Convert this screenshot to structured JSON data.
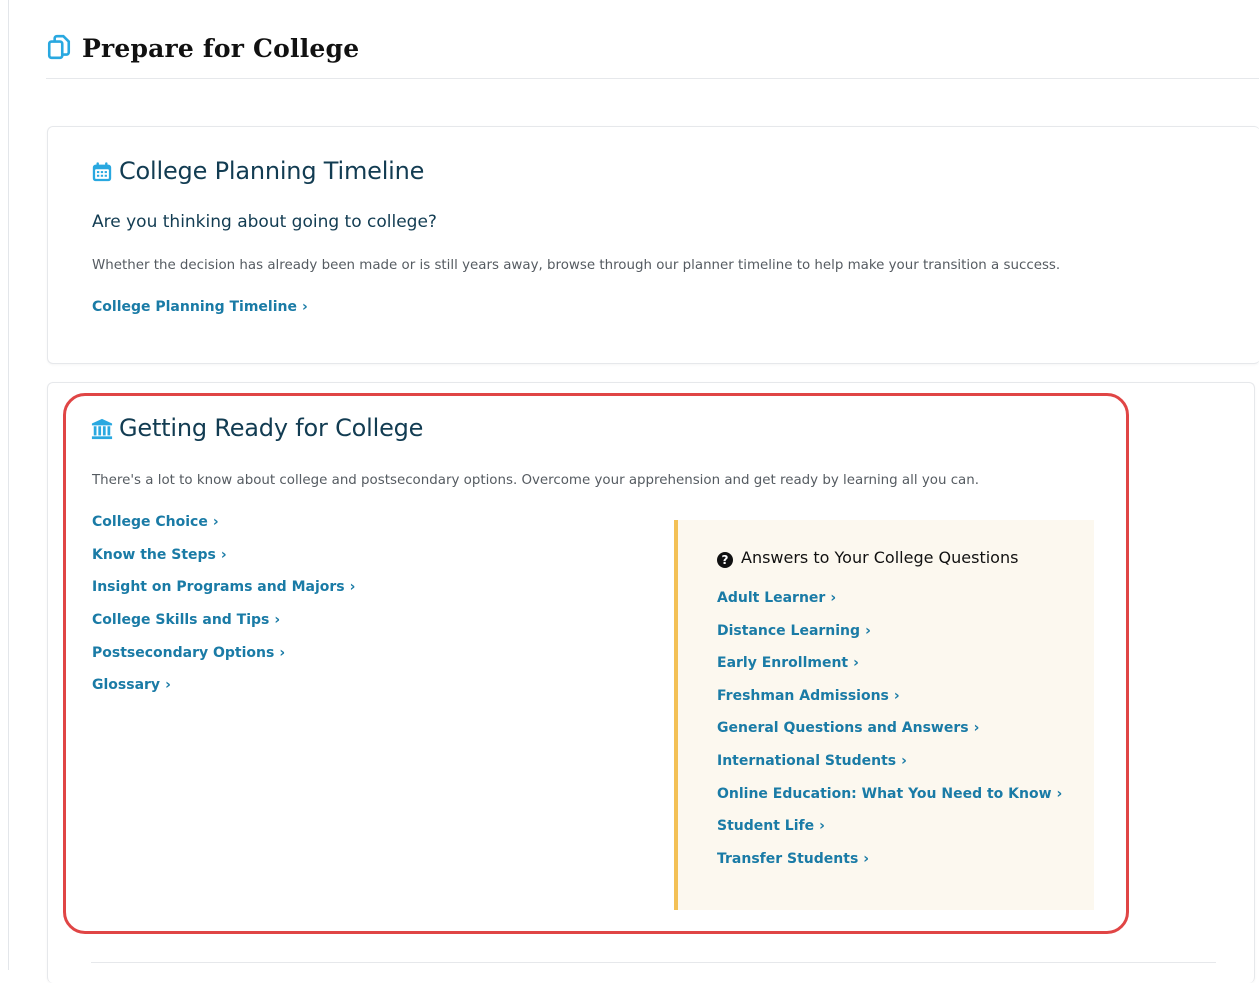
{
  "page": {
    "title": "Prepare for College",
    "icon": "copy-pages-icon"
  },
  "timeline_card": {
    "icon": "calendar-icon",
    "title": "College Planning Timeline",
    "subheading": "Are you thinking about going to college?",
    "description": "Whether the decision has already been made or is still years away, browse through our planner timeline to help make your transition a success.",
    "link_label": "College Planning Timeline"
  },
  "ready_card": {
    "icon": "bank-building-icon",
    "title": "Getting Ready for College",
    "description": "There's a lot to know about college and postsecondary options. Overcome your apprehension and get ready by learning all you can.",
    "links": [
      {
        "label": "College Choice"
      },
      {
        "label": "Know the Steps"
      },
      {
        "label": "Insight on Programs and Majors"
      },
      {
        "label": "College Skills and Tips"
      },
      {
        "label": "Postsecondary Options"
      },
      {
        "label": "Glossary"
      }
    ],
    "questions": {
      "icon": "question-circle-icon",
      "title": "Answers to Your College Questions",
      "links": [
        {
          "label": "Adult Learner"
        },
        {
          "label": "Distance Learning"
        },
        {
          "label": "Early Enrollment"
        },
        {
          "label": "Freshman Admissions"
        },
        {
          "label": "General Questions and Answers"
        },
        {
          "label": "International Students"
        },
        {
          "label": "Online Education: What You Need to Know"
        },
        {
          "label": "Student Life"
        },
        {
          "label": "Transfer Students"
        }
      ]
    }
  },
  "colors": {
    "link": "#1a7ba6",
    "heading": "#123c52",
    "icon": "#29a8e0",
    "callout_border": "#f3c055",
    "callout_bg": "#fcf8ef",
    "highlight": "#e04545"
  },
  "chevron": "›"
}
